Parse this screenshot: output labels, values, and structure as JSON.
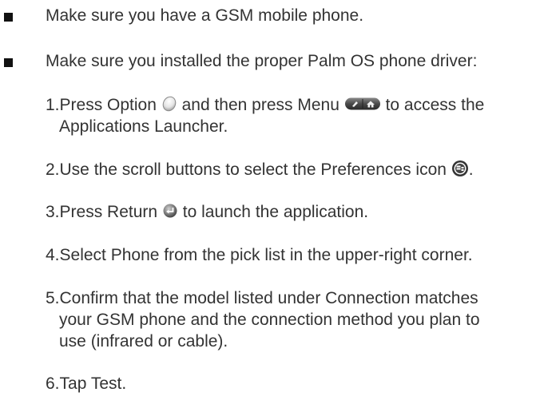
{
  "bullets": [
    "Make sure you have a GSM mobile phone.",
    "Make sure you installed the proper Palm OS phone driver:"
  ],
  "steps": {
    "s1": {
      "a": "1.Press Option",
      "b": "and then press Menu",
      "c": "to access the",
      "d": "Applications Launcher."
    },
    "s2": {
      "a": "2.Use the scroll buttons to select the Preferences icon",
      "b": "."
    },
    "s3": {
      "a": "3.Press Return",
      "b": "to launch the application."
    },
    "s4": {
      "a": "4.Select Phone from the pick list in the upper-right corner."
    },
    "s5": {
      "a": "5.Confirm that the model listed under Connection matches",
      "b": "your GSM phone and the connection method you plan to",
      "c": "use (infrared or cable)."
    },
    "s6": {
      "a": "6.Tap Test."
    }
  },
  "icons": {
    "option": "option-key-icon",
    "menu": "menu-key-icon",
    "preferences": "preferences-icon",
    "return": "return-key-icon"
  }
}
